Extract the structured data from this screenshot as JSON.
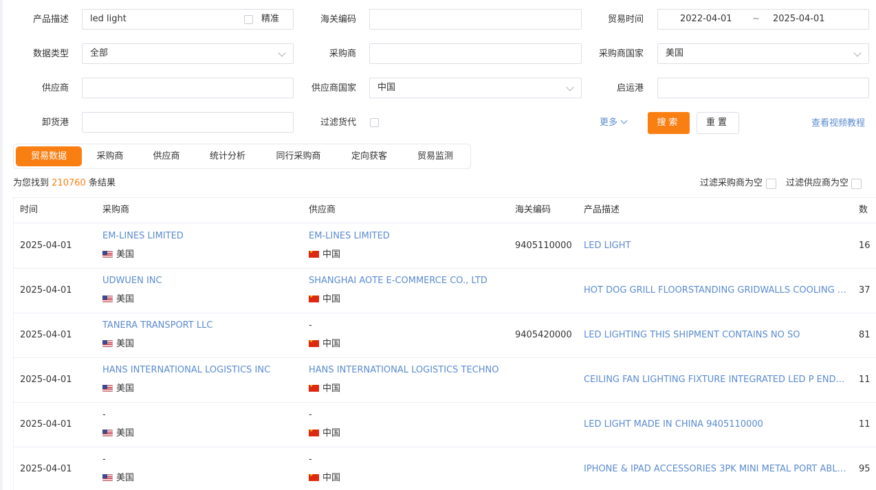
{
  "search": {
    "product_label": "产品描述",
    "product_value": "led light",
    "exact_label": "精准",
    "hs_label": "海关编码",
    "hs_value": "",
    "trade_time_label": "贸易时间",
    "date_from": "2022-04-01",
    "date_sep": "~",
    "date_to": "2025-04-01",
    "data_type_label": "数据类型",
    "data_type_value": "全部",
    "buyer_label": "采购商",
    "buyer_value": "",
    "buyer_country_label": "采购商国家",
    "buyer_country_value": "美国",
    "supplier_label": "供应商",
    "supplier_value": "",
    "supplier_country_label": "供应商国家",
    "supplier_country_value": "中国",
    "departure_port_label": "启运港",
    "departure_port_value": "",
    "arrival_port_label": "卸货港",
    "arrival_port_value": "",
    "filter_forwarder_label": "过滤货代",
    "more_label": "更多",
    "search_button": "搜索",
    "reset_button": "重置",
    "video_link": "查看视频教程"
  },
  "tabs": [
    {
      "label": "贸易数据",
      "active": true
    },
    {
      "label": "采购商",
      "active": false
    },
    {
      "label": "供应商",
      "active": false
    },
    {
      "label": "统计分析",
      "active": false
    },
    {
      "label": "同行采购商",
      "active": false
    },
    {
      "label": "定向获客",
      "active": false
    },
    {
      "label": "贸易监测",
      "active": false
    }
  ],
  "results": {
    "prefix": "为您找到",
    "count": "210760",
    "suffix": "条结果",
    "filter_buyer_empty": "过滤采购商为空",
    "filter_supplier_empty": "过滤供应商为空"
  },
  "table": {
    "headers": {
      "time": "时间",
      "buyer": "采购商",
      "supplier": "供应商",
      "hs": "海关编码",
      "desc": "产品描述",
      "qty": "数"
    },
    "rows": [
      {
        "time": "2025-04-01",
        "buyer": "EM-LINES LIMITED",
        "buyer_country": "美国",
        "supplier": "EM-LINES LIMITED",
        "supplier_country": "中国",
        "hs": "9405110000",
        "desc": "LED LIGHT",
        "qty": "16"
      },
      {
        "time": "2025-04-01",
        "buyer": "UDWUEN INC",
        "buyer_country": "美国",
        "supplier": "SHANGHAI AOTE E-COMMERCE CO., LTD",
        "supplier_country": "中国",
        "hs": "",
        "desc": "HOT DOG GRILL FLOORSTANDING GRIDWALLS COOLING F...",
        "qty": "37"
      },
      {
        "time": "2025-04-01",
        "buyer": "TANERA TRANSPORT LLC",
        "buyer_country": "美国",
        "supplier": "-",
        "supplier_country": "中国",
        "hs": "9405420000",
        "desc": "LED LIGHTING THIS SHIPMENT CONTAINS NO SO",
        "qty": "81"
      },
      {
        "time": "2025-04-01",
        "buyer": "HANS INTERNATIONAL LOGISTICS INC",
        "buyer_country": "美国",
        "supplier": "HANS INTERNATIONAL LOGISTICS TECHNO",
        "supplier_country": "中国",
        "hs": "",
        "desc": "CEILING FAN LIGHTING FIXTURE INTEGRATED LED P ENDA...",
        "qty": "11"
      },
      {
        "time": "2025-04-01",
        "buyer": "-",
        "buyer_country": "美国",
        "supplier": "-",
        "supplier_country": "中国",
        "hs": "",
        "desc": "LED LIGHT MADE IN CHINA 9405110000",
        "qty": "11"
      },
      {
        "time": "2025-04-01",
        "buyer": "-",
        "buyer_country": "美国",
        "supplier": "-",
        "supplier_country": "中国",
        "hs": "",
        "desc": "IPHONE & IPAD ACCESSORIES 3PK MINI METAL PORT ABLE...",
        "qty": "95"
      }
    ]
  },
  "colors": {
    "accent": "#fa7f13",
    "link": "#5b8bd0",
    "border": "#dcdfe6"
  }
}
